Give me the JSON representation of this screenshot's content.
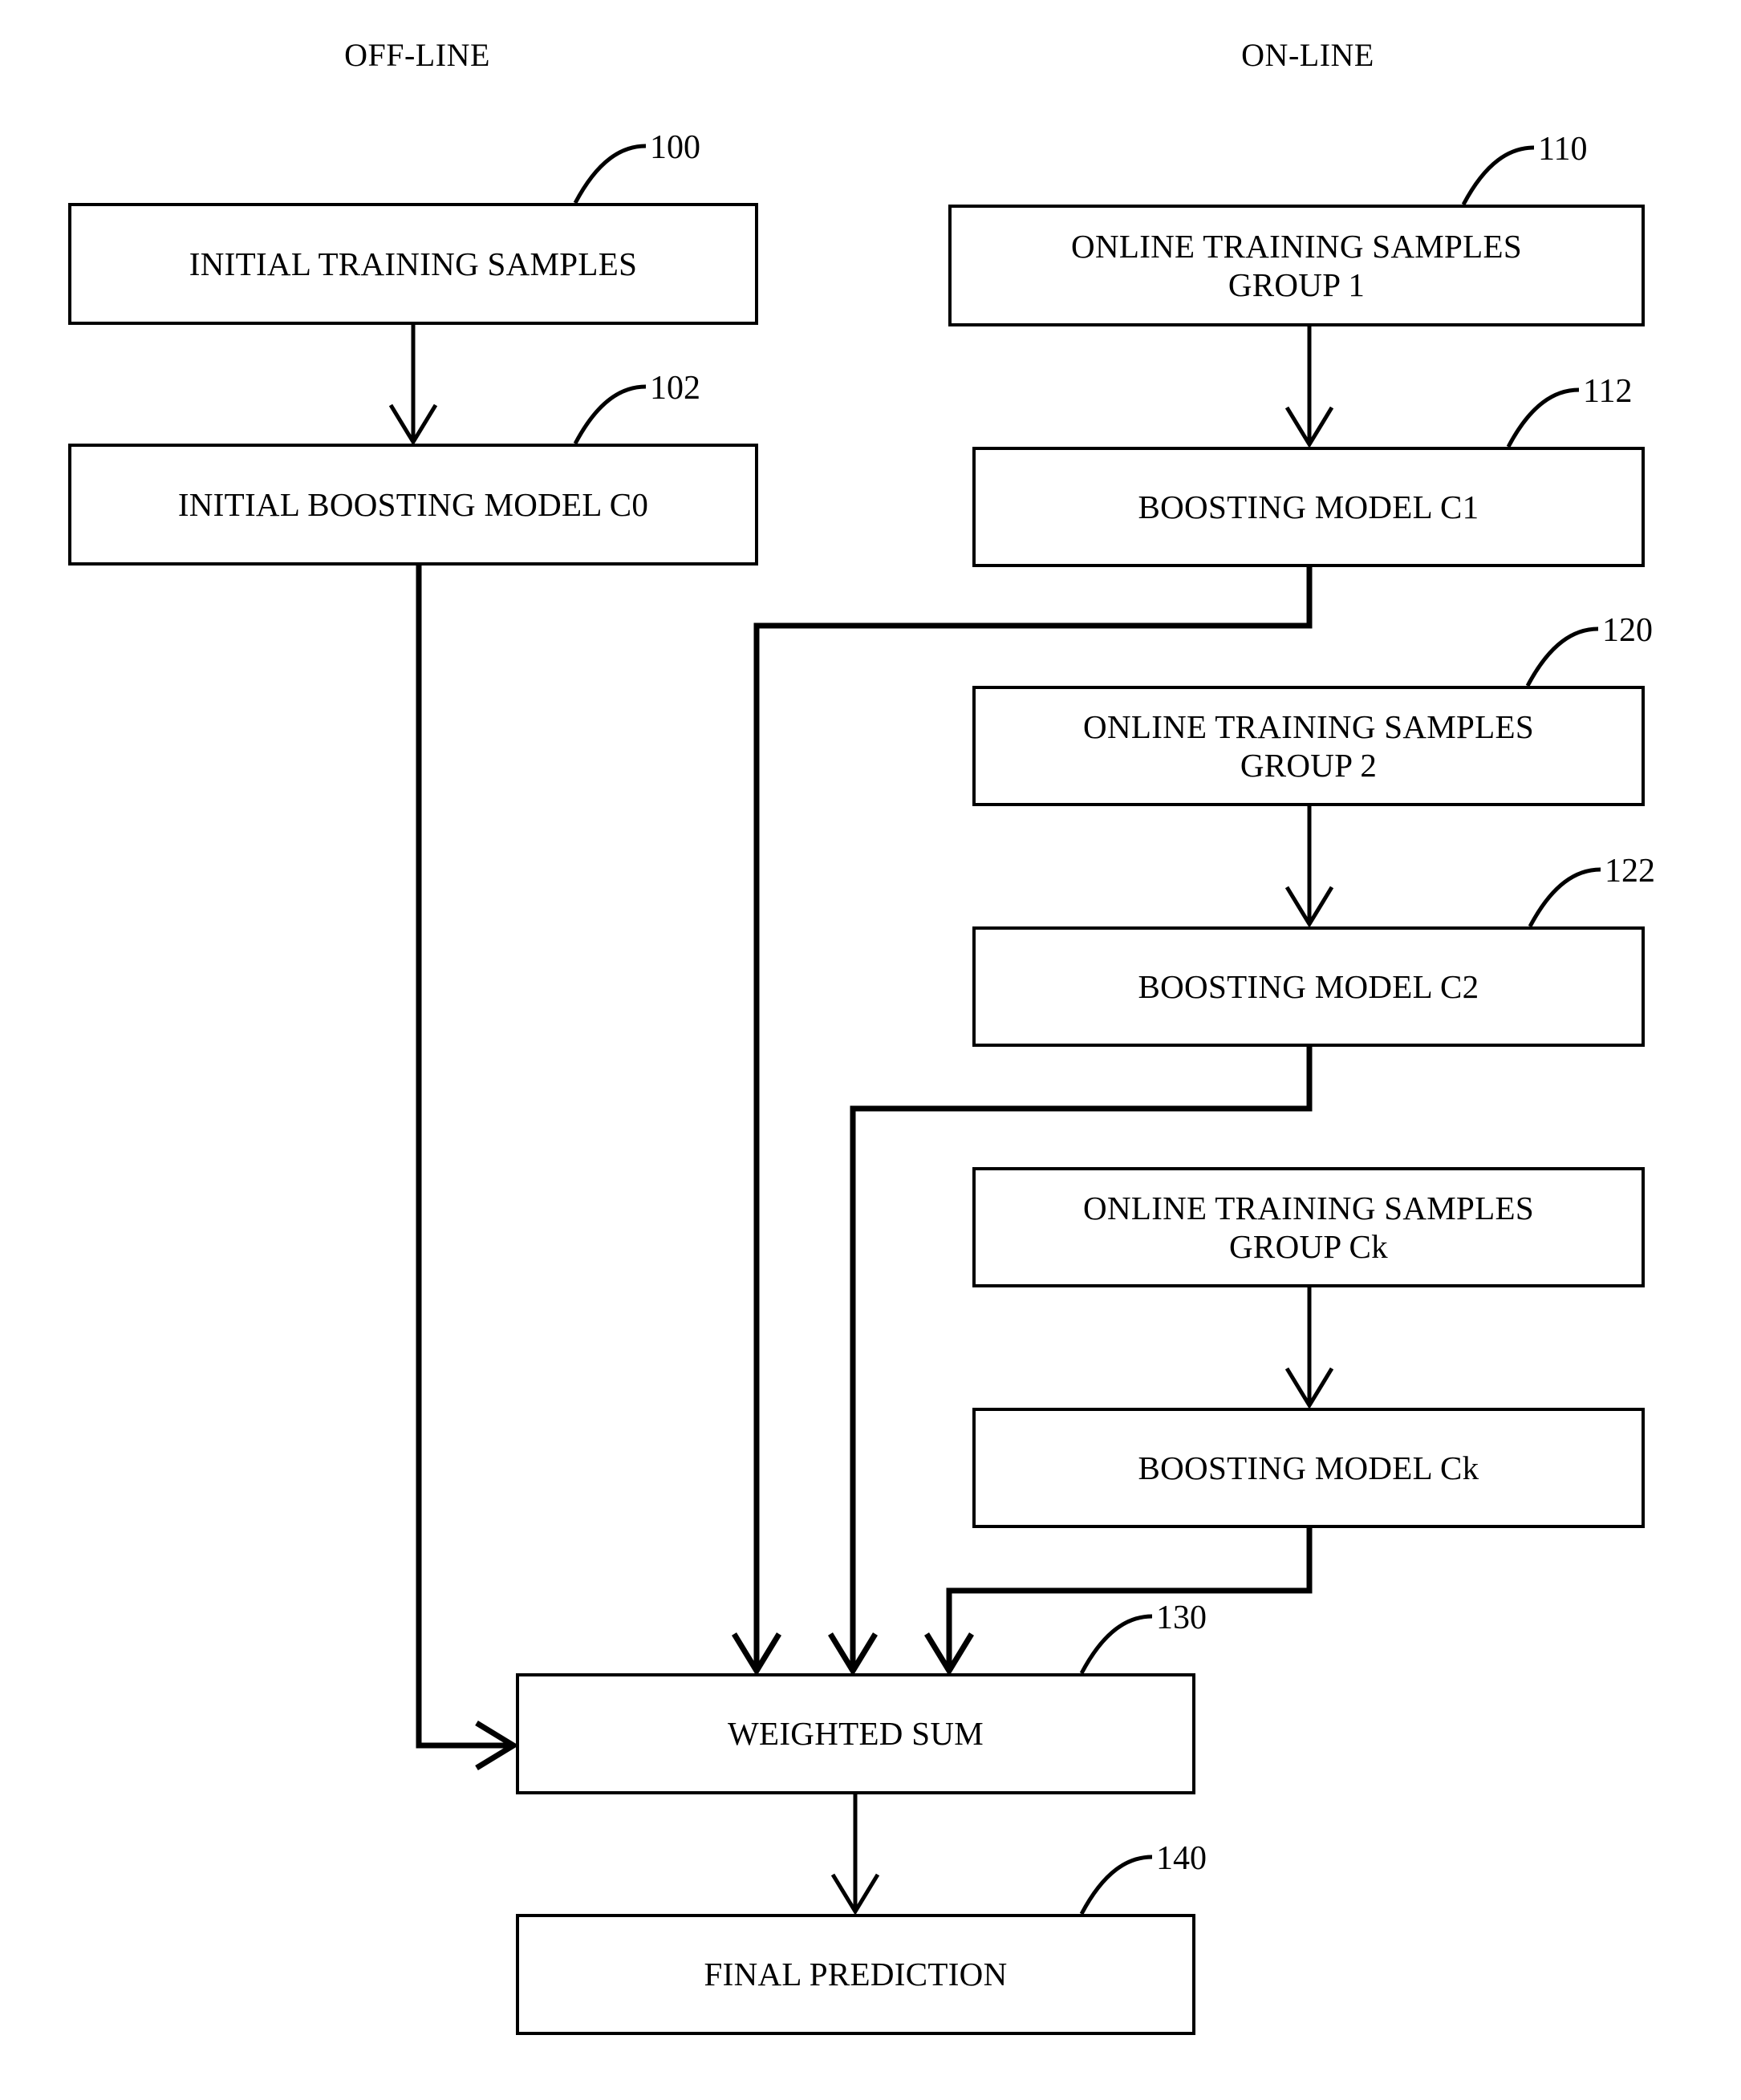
{
  "figure": {
    "type": "patent-flowchart",
    "ink_color": "#000000",
    "background_color": "#ffffff"
  },
  "columns": [
    {
      "id": "offline",
      "label": "OFF-LINE"
    },
    {
      "id": "online",
      "label": "ON-LINE"
    }
  ],
  "nodes": [
    {
      "id": "initial_training_samples",
      "label": "INITIAL TRAINING SAMPLES",
      "ref": "100"
    },
    {
      "id": "initial_boosting_model_c0",
      "label": "INITIAL BOOSTING MODEL C0",
      "ref": "102"
    },
    {
      "id": "online_training_samples_group_1",
      "label": "ONLINE TRAINING SAMPLES\nGROUP 1",
      "ref": "110"
    },
    {
      "id": "boosting_model_c1",
      "label": "BOOSTING MODEL C1",
      "ref": "112"
    },
    {
      "id": "online_training_samples_group_2",
      "label": "ONLINE TRAINING SAMPLES\nGROUP 2",
      "ref": "120"
    },
    {
      "id": "boosting_model_c2",
      "label": "BOOSTING MODEL C2",
      "ref": "122"
    },
    {
      "id": "online_training_samples_group_ck",
      "label": "ONLINE TRAINING SAMPLES\nGROUP Ck",
      "ref": ""
    },
    {
      "id": "boosting_model_ck",
      "label": "BOOSTING MODEL Ck",
      "ref": ""
    },
    {
      "id": "weighted_sum",
      "label": "WEIGHTED SUM",
      "ref": "130"
    },
    {
      "id": "final_prediction",
      "label": "FINAL PREDICTION",
      "ref": "140"
    }
  ],
  "edges": [
    {
      "from": "initial_training_samples",
      "to": "initial_boosting_model_c0"
    },
    {
      "from": "initial_boosting_model_c0",
      "to": "weighted_sum"
    },
    {
      "from": "online_training_samples_group_1",
      "to": "boosting_model_c1"
    },
    {
      "from": "boosting_model_c1",
      "to": "weighted_sum"
    },
    {
      "from": "online_training_samples_group_2",
      "to": "boosting_model_c2"
    },
    {
      "from": "boosting_model_c2",
      "to": "weighted_sum"
    },
    {
      "from": "online_training_samples_group_ck",
      "to": "boosting_model_ck"
    },
    {
      "from": "boosting_model_ck",
      "to": "weighted_sum"
    },
    {
      "from": "weighted_sum",
      "to": "final_prediction"
    }
  ]
}
